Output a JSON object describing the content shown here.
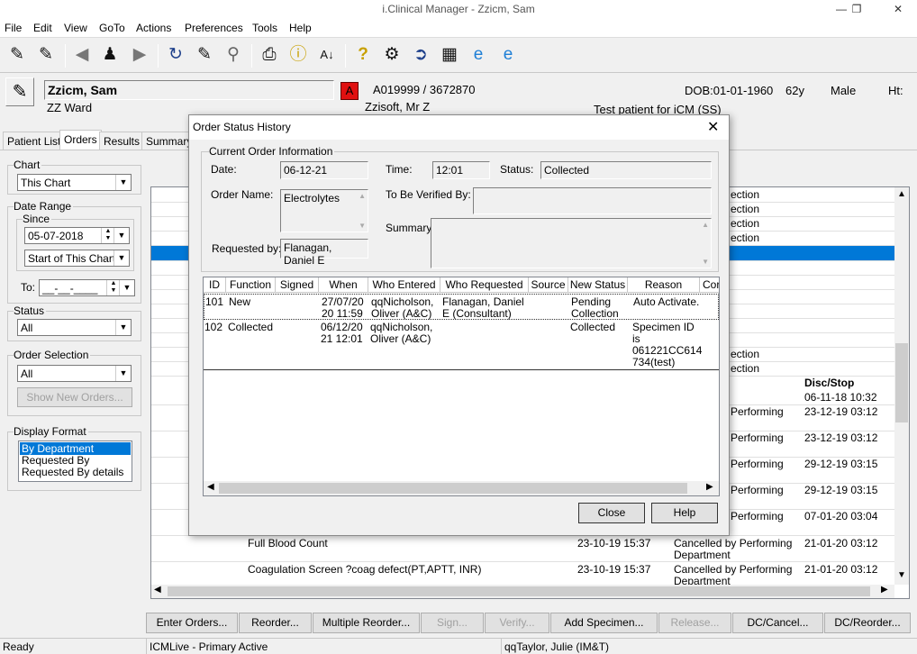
{
  "window": {
    "title": "i.Clinical Manager - Zzicm, Sam",
    "min": "—",
    "max": "❐",
    "close": "✕"
  },
  "menu": [
    "File",
    "Edit",
    "View",
    "GoTo",
    "Actions",
    "Preferences",
    "Tools",
    "Help"
  ],
  "patient": {
    "name": "Zzicm, Sam",
    "ward": "ZZ Ward",
    "alert": "A",
    "ids": "A019999 / 3672870",
    "consultant": "Zzisoft, Mr Z",
    "dob": "DOB:01-01-1960",
    "age": "62y",
    "sex": "Male",
    "ht": "Ht:",
    "note": "Test patient for iCM (SS)"
  },
  "tabs": [
    "Patient List",
    "Orders",
    "Results",
    "Summary"
  ],
  "left": {
    "chart_label": "Chart",
    "chart_value": "This Chart",
    "date_range_label": "Date Range",
    "since_label": "Since",
    "since_date": "05-07-2018",
    "since_option": "Start of This Chart",
    "to_label": "To:",
    "to_value": "__-__-____",
    "status_label": "Status",
    "status_value": "All",
    "order_sel_label": "Order Selection",
    "order_sel_value": "All",
    "show_new_orders": "Show New Orders...",
    "display_format_label": "Display Format",
    "display_formats": [
      "By Department",
      "Requested By",
      "Requested By details"
    ]
  },
  "bg_table": {
    "right_partial": [
      "ection",
      "ection",
      "ection",
      "ection",
      "ection",
      "ection"
    ],
    "disc_header": "Disc/Stop",
    "rows": [
      {
        "status": "",
        "disc": "06-11-18 10:32"
      },
      {
        "status": "Performing",
        "disc": "23-12-19 03:12"
      },
      {
        "status": "Performing",
        "disc": "23-12-19 03:12"
      },
      {
        "status": "Performing",
        "disc": "29-12-19 03:15"
      },
      {
        "status": "Performing",
        "disc": "29-12-19 03:15"
      },
      {
        "status": "Performing",
        "disc": "07-01-20 03:04"
      }
    ],
    "bottom_rows": [
      {
        "name": "Full Blood Count",
        "date": "23-10-19 15:37",
        "status1": "Cancelled by Performing",
        "status2": "Department",
        "disc": "21-01-20 03:12"
      },
      {
        "name": "Coagulation Screen ?coag defect(PT,APTT, INR)",
        "date": "23-10-19 15:37",
        "status1": "Cancelled by Performing",
        "status2": "Department",
        "disc": "21-01-20 03:12"
      }
    ]
  },
  "bottom_buttons": [
    {
      "label": "Enter Orders...",
      "enabled": true
    },
    {
      "label": "Reorder...",
      "enabled": true
    },
    {
      "label": "Multiple Reorder...",
      "enabled": true
    },
    {
      "label": "Sign...",
      "enabled": false
    },
    {
      "label": "Verify...",
      "enabled": false
    },
    {
      "label": "Add Specimen...",
      "enabled": true
    },
    {
      "label": "Release...",
      "enabled": false
    },
    {
      "label": "DC/Cancel...",
      "enabled": true
    },
    {
      "label": "DC/Reorder...",
      "enabled": true
    }
  ],
  "statusbar": {
    "ready": "Ready",
    "env": "ICMLive - Primary Active",
    "user": "qqTaylor, Julie (IM&T)"
  },
  "dialog": {
    "title": "Order Status History",
    "group_label": "Current Order Information",
    "date_label": "Date:",
    "date_value": "06-12-21",
    "time_label": "Time:",
    "time_value": "12:01",
    "status_label": "Status:",
    "status_value": "Collected",
    "order_name_label": "Order Name:",
    "order_name_value": "Electrolytes",
    "verified_label": "To Be Verified By:",
    "verified_value": "",
    "summary_label": "Summary:",
    "summary_value": "",
    "requested_label": "Requested by:",
    "requested_value": "Flanagan, Daniel E",
    "columns": [
      "ID",
      "Function",
      "Signed",
      "When",
      "Who Entered",
      "Who Requested",
      "Source",
      "New Status",
      "Reason",
      "Cor"
    ],
    "rows": [
      {
        "id": "101",
        "function": "New",
        "signed": "",
        "when": "27/07/20 20 11:59",
        "who_entered": "qqNicholson, Oliver  (A&C)",
        "who_requested": "Flanagan, Daniel E (Consultant)",
        "source": "",
        "new_status": "Pending Collection",
        "reason": "Auto Activate."
      },
      {
        "id": "102",
        "function": "Collected",
        "signed": "",
        "when": "06/12/20 21 12:01",
        "who_entered": "qqNicholson, Oliver  (A&C)",
        "who_requested": "",
        "source": "",
        "new_status": "Collected",
        "reason": "Specimen ID is 061221CC614 734(test)"
      }
    ],
    "close_btn": "Close",
    "help_btn": "Help"
  }
}
